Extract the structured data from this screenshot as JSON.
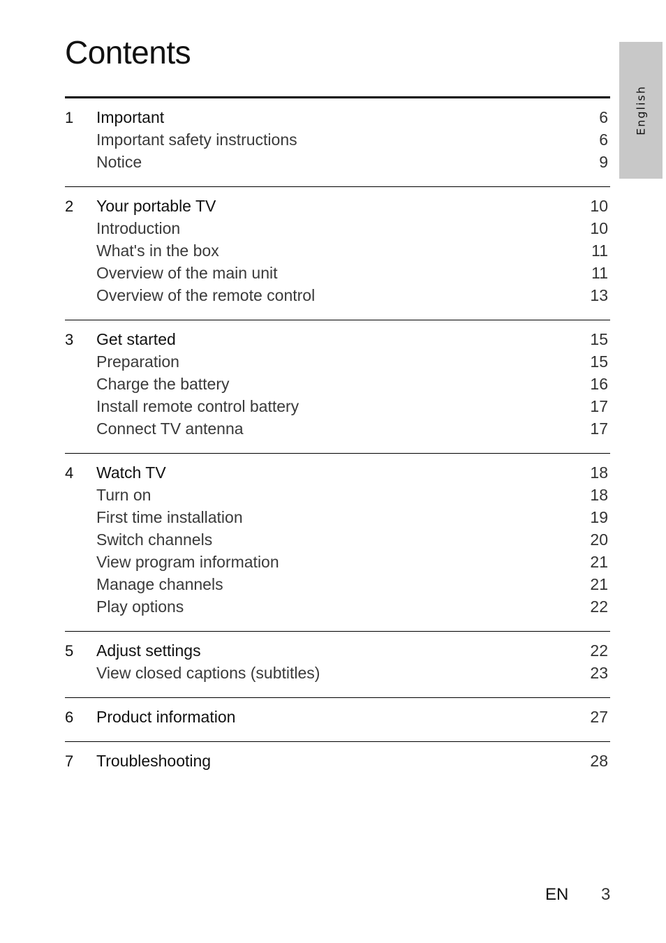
{
  "page_title": "Contents",
  "language_tab": "English",
  "sections": [
    {
      "number": "1",
      "title": "Important",
      "page": "6",
      "items": [
        {
          "title": "Important safety instructions",
          "page": "6"
        },
        {
          "title": "Notice",
          "page": "9"
        }
      ]
    },
    {
      "number": "2",
      "title": "Your portable TV",
      "page": "10",
      "items": [
        {
          "title": "Introduction",
          "page": "10"
        },
        {
          "title": "What's in the box",
          "page": "11"
        },
        {
          "title": "Overview of the main unit",
          "page": "11"
        },
        {
          "title": "Overview of the remote control",
          "page": "13"
        }
      ]
    },
    {
      "number": "3",
      "title": "Get started",
      "page": "15",
      "items": [
        {
          "title": "Preparation",
          "page": "15"
        },
        {
          "title": "Charge the battery",
          "page": "16"
        },
        {
          "title": "Install remote control battery",
          "page": "17"
        },
        {
          "title": "Connect TV antenna",
          "page": "17"
        }
      ]
    },
    {
      "number": "4",
      "title": "Watch TV",
      "page": "18",
      "items": [
        {
          "title": "Turn on",
          "page": "18"
        },
        {
          "title": "First time installation",
          "page": "19"
        },
        {
          "title": "Switch channels",
          "page": "20"
        },
        {
          "title": "View program information",
          "page": "21"
        },
        {
          "title": "Manage channels",
          "page": "21"
        },
        {
          "title": "Play options",
          "page": "22"
        }
      ]
    },
    {
      "number": "5",
      "title": "Adjust settings",
      "page": "22",
      "items": [
        {
          "title": "View closed captions (subtitles)",
          "page": "23"
        }
      ]
    },
    {
      "number": "6",
      "title": "Product information",
      "page": "27",
      "items": []
    },
    {
      "number": "7",
      "title": "Troubleshooting",
      "page": "28",
      "items": []
    }
  ],
  "footer": {
    "language_code": "EN",
    "page_number": "3"
  }
}
